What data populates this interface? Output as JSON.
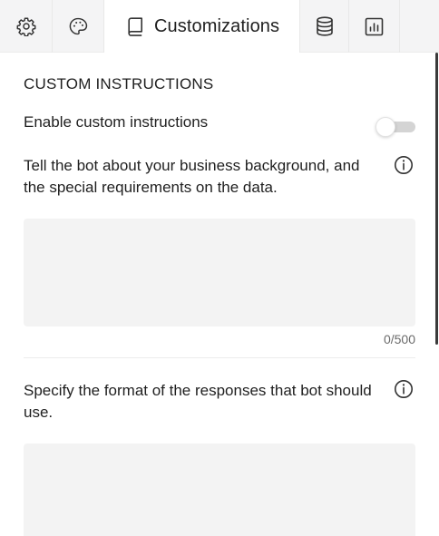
{
  "tabs": [
    {
      "name": "tab-settings",
      "icon": "gear-icon",
      "label": ""
    },
    {
      "name": "tab-appearance",
      "icon": "palette-icon",
      "label": ""
    },
    {
      "name": "tab-customizations",
      "icon": "book-icon",
      "label": "Customizations",
      "active": true
    },
    {
      "name": "tab-data-sources",
      "icon": "database-icon",
      "label": ""
    },
    {
      "name": "tab-charts",
      "icon": "chart-icon",
      "label": ""
    }
  ],
  "active_tab_label": "Customizations",
  "custom_instructions": {
    "section_title": "CUSTOM INSTRUCTIONS",
    "toggle_label": "Enable custom instructions",
    "toggle_enabled": false,
    "background_prompt": "Tell the bot about your business background, and the special requirements on the data.",
    "background_value": "",
    "background_counter": "0/500",
    "format_prompt": "Specify the format of the responses that bot should use.",
    "format_value": ""
  },
  "colors": {
    "tabbar_bg": "#f4f4f5",
    "textarea_bg": "#f3f3f3",
    "toggle_track": "#d4d4d4",
    "text": "#1f1f1f",
    "muted_text": "#6b6b6b"
  },
  "icons": [
    "gear-icon",
    "palette-icon",
    "book-icon",
    "database-icon",
    "chart-icon",
    "info-icon"
  ]
}
